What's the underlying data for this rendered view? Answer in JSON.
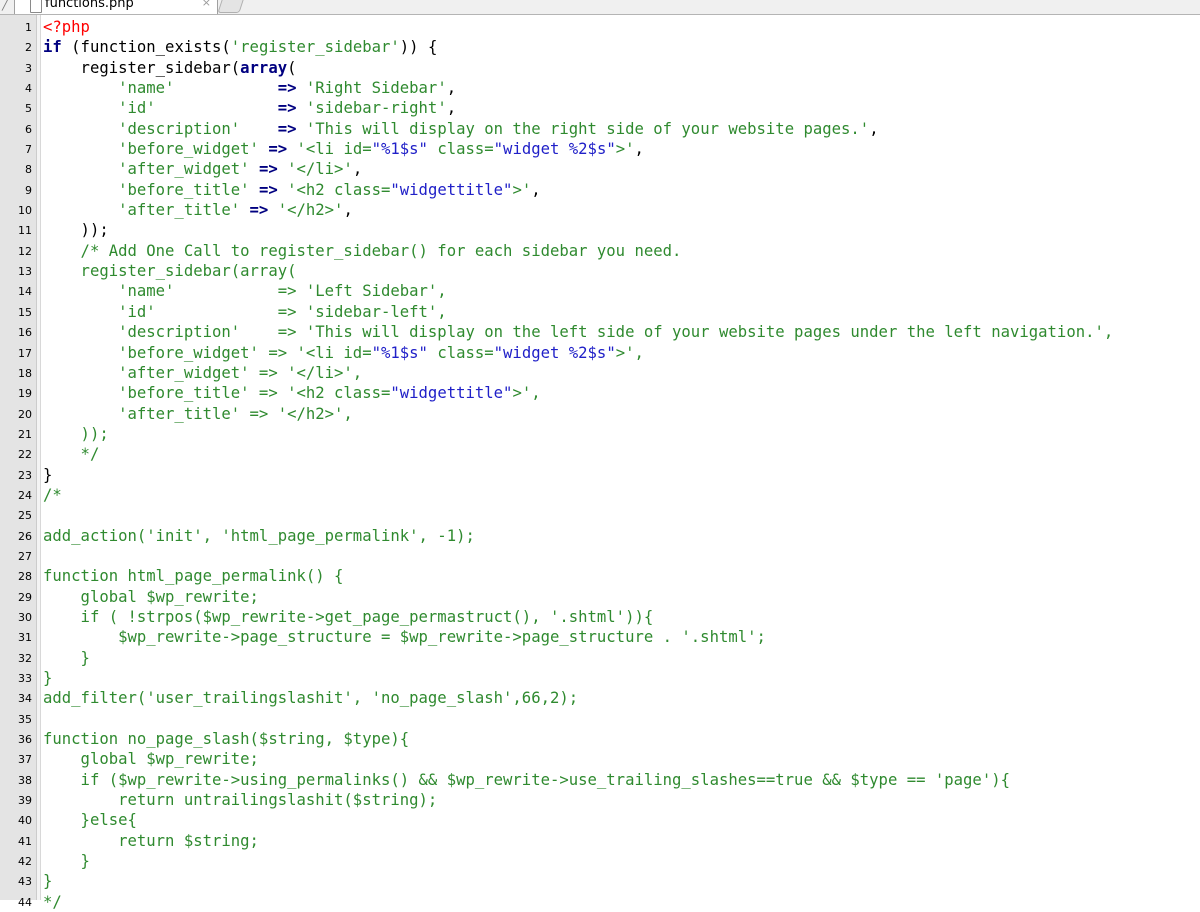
{
  "tab": {
    "label": "functions.php",
    "close": "×"
  },
  "lines": [
    [
      [
        "php",
        "<?php"
      ]
    ],
    [
      [
        "bold",
        "if"
      ],
      [
        "plain",
        " (function_exists("
      ],
      [
        "str",
        "'register_sidebar'"
      ],
      [
        "plain",
        ")) {"
      ]
    ],
    [
      [
        "plain",
        "    register_sidebar("
      ],
      [
        "bold",
        "array"
      ],
      [
        "plain",
        "("
      ]
    ],
    [
      [
        "str",
        "        'name'           "
      ],
      [
        "bold",
        "=>"
      ],
      [
        "str",
        " 'Right Sidebar'"
      ],
      [
        "plain",
        ","
      ]
    ],
    [
      [
        "str",
        "        'id'             "
      ],
      [
        "bold",
        "=>"
      ],
      [
        "str",
        " 'sidebar-right'"
      ],
      [
        "plain",
        ","
      ]
    ],
    [
      [
        "str",
        "        'description'    "
      ],
      [
        "bold",
        "=>"
      ],
      [
        "str",
        " 'This will display on the right side of your website pages.'"
      ],
      [
        "plain",
        ","
      ]
    ],
    [
      [
        "str",
        "        'before_widget' "
      ],
      [
        "bold",
        "=>"
      ],
      [
        "str",
        " '<li id="
      ],
      [
        "tag",
        "\"%1$s\""
      ],
      [
        "str",
        " class="
      ],
      [
        "tag",
        "\"widget %2$s\""
      ],
      [
        "str",
        ">'"
      ],
      [
        "plain",
        ","
      ]
    ],
    [
      [
        "str",
        "        'after_widget' "
      ],
      [
        "bold",
        "=>"
      ],
      [
        "str",
        " '</li>'"
      ],
      [
        "plain",
        ","
      ]
    ],
    [
      [
        "str",
        "        'before_title' "
      ],
      [
        "bold",
        "=>"
      ],
      [
        "str",
        " '<h2 class="
      ],
      [
        "tag",
        "\"widgettitle\""
      ],
      [
        "str",
        ">'"
      ],
      [
        "plain",
        ","
      ]
    ],
    [
      [
        "str",
        "        'after_title' "
      ],
      [
        "bold",
        "=>"
      ],
      [
        "str",
        " '</h2>'"
      ],
      [
        "plain",
        ","
      ]
    ],
    [
      [
        "plain",
        "    ));"
      ]
    ],
    [
      [
        "str",
        "    /* Add One Call to register_sidebar() for each sidebar you need."
      ]
    ],
    [
      [
        "str",
        "    register_sidebar(array("
      ]
    ],
    [
      [
        "str",
        "        'name'           => 'Left Sidebar',"
      ]
    ],
    [
      [
        "str",
        "        'id'             => 'sidebar-left',"
      ]
    ],
    [
      [
        "str",
        "        'description'    => 'This will display on the left side of your website pages under the left navigation.',"
      ]
    ],
    [
      [
        "str",
        "        'before_widget' => '<li id="
      ],
      [
        "tag",
        "\"%1$s\""
      ],
      [
        "str",
        " class="
      ],
      [
        "tag",
        "\"widget %2$s\""
      ],
      [
        "str",
        ">',"
      ]
    ],
    [
      [
        "str",
        "        'after_widget' => '</li>',"
      ]
    ],
    [
      [
        "str",
        "        'before_title' => '<h2 class="
      ],
      [
        "tag",
        "\"widgettitle\""
      ],
      [
        "str",
        ">',"
      ]
    ],
    [
      [
        "str",
        "        'after_title' => '</h2>',"
      ]
    ],
    [
      [
        "str",
        "    ));"
      ]
    ],
    [
      [
        "str",
        "    */"
      ]
    ],
    [
      [
        "plain",
        "}"
      ]
    ],
    [
      [
        "str",
        "/*"
      ]
    ],
    [
      [
        "str",
        ""
      ]
    ],
    [
      [
        "str",
        "add_action('init', 'html_page_permalink', -1);"
      ]
    ],
    [
      [
        "str",
        ""
      ]
    ],
    [
      [
        "str",
        "function html_page_permalink() {"
      ]
    ],
    [
      [
        "str",
        "    global $wp_rewrite;"
      ]
    ],
    [
      [
        "str",
        "    if ( !strpos($wp_rewrite->get_page_permastruct(), '.shtml')){"
      ]
    ],
    [
      [
        "str",
        "        $wp_rewrite->page_structure = $wp_rewrite->page_structure . '.shtml';"
      ]
    ],
    [
      [
        "str",
        "    }"
      ]
    ],
    [
      [
        "str",
        "}"
      ]
    ],
    [
      [
        "str",
        "add_filter('user_trailingslashit', 'no_page_slash',66,2);"
      ]
    ],
    [
      [
        "str",
        ""
      ]
    ],
    [
      [
        "str",
        "function no_page_slash($string, $type){"
      ]
    ],
    [
      [
        "str",
        "    global $wp_rewrite;"
      ]
    ],
    [
      [
        "str",
        "    if ($wp_rewrite->using_permalinks() && $wp_rewrite->use_trailing_slashes==true && $type == 'page'){"
      ]
    ],
    [
      [
        "str",
        "        return untrailingslashit($string);"
      ]
    ],
    [
      [
        "str",
        "    }else{"
      ]
    ],
    [
      [
        "str",
        "        return $string;"
      ]
    ],
    [
      [
        "str",
        "    }"
      ]
    ],
    [
      [
        "str",
        "}"
      ]
    ],
    [
      [
        "str",
        "*/"
      ]
    ]
  ],
  "line_numbers": [
    "1",
    "2",
    "3",
    "4",
    "5",
    "6",
    "7",
    "8",
    "9",
    "10",
    "11",
    "12",
    "13",
    "14",
    "15",
    "16",
    "17",
    "18",
    "19",
    "20",
    "21",
    "22",
    "23",
    "24",
    "25",
    "26",
    "27",
    "28",
    "29",
    "30",
    "31",
    "32",
    "33",
    "34",
    "35",
    "36",
    "37",
    "38",
    "39",
    "40",
    "41",
    "42",
    "43",
    "44"
  ],
  "colors": {
    "string": "#2f8a2f",
    "keyword": "#000080",
    "attr_value": "#2020c8",
    "php_tag": "#ff0000",
    "gutter": "#e4e4e4"
  }
}
